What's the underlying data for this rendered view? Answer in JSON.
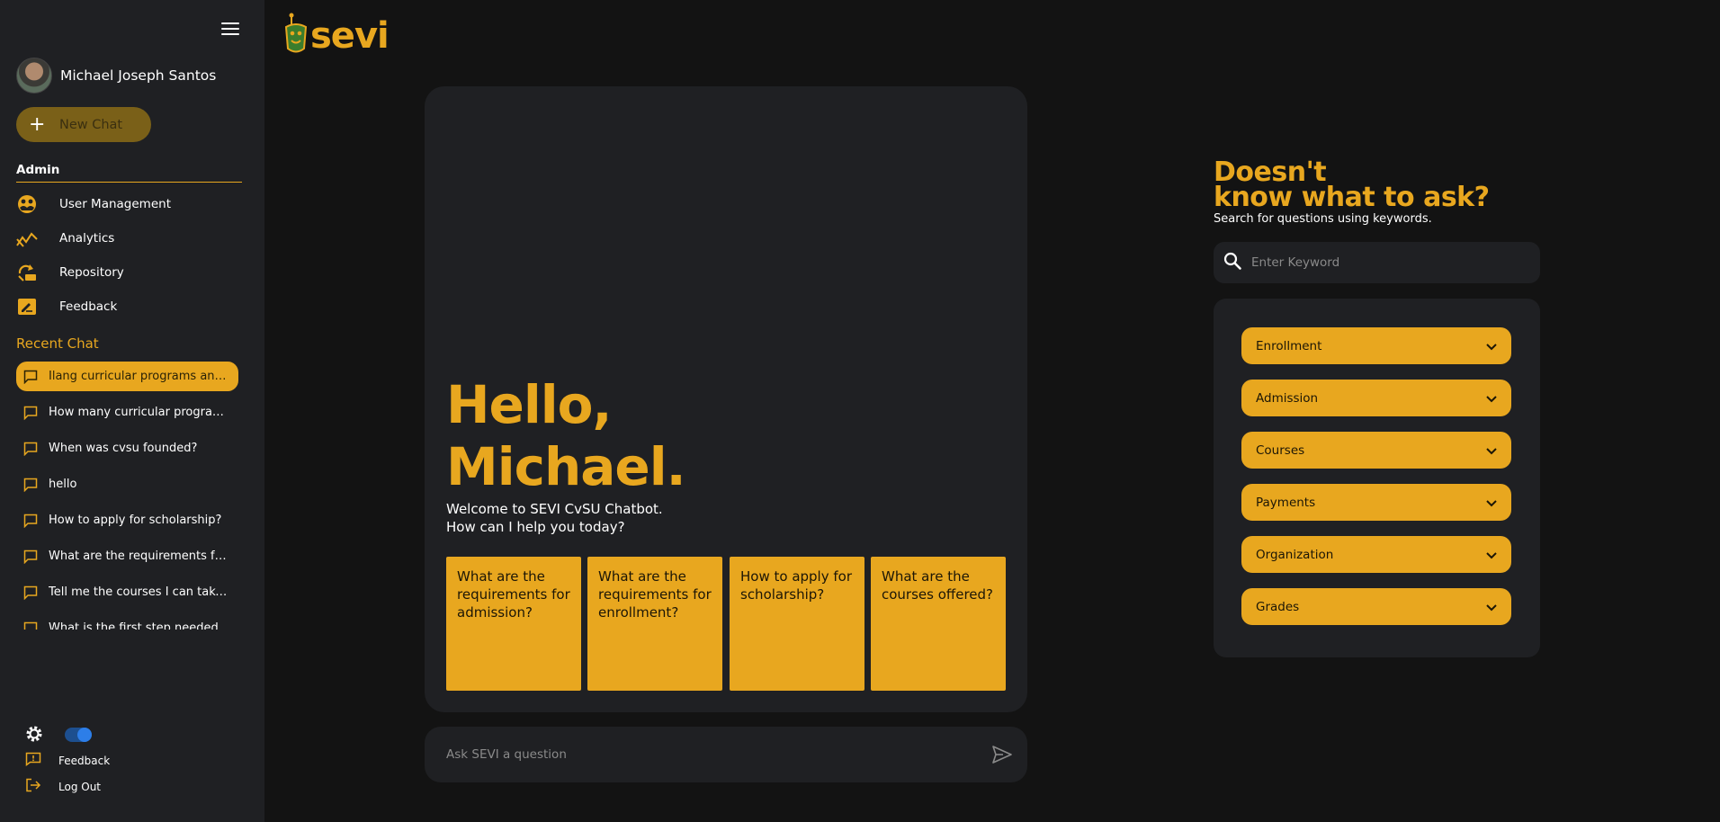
{
  "user": {
    "name": "Michael Joseph Santos"
  },
  "sidebar": {
    "new_chat_label": "New Chat",
    "admin_title": "Admin",
    "nav": [
      {
        "label": "User Management",
        "icon": "user-management-icon"
      },
      {
        "label": "Analytics",
        "icon": "analytics-icon"
      },
      {
        "label": "Repository",
        "icon": "repository-icon"
      },
      {
        "label": "Feedback",
        "icon": "feedback-icon"
      }
    ],
    "recent_title": "Recent Chat",
    "recent_chats": [
      "Ilang curricular programs ang i...",
      "How many curricular programs...",
      "When was cvsu founded?",
      "hello",
      "How to apply for scholarship?",
      "What are the requirements for ...",
      "Tell me the courses I can take in...",
      "What is the first step needed to..."
    ],
    "bottom": {
      "feedback_label": "Feedback",
      "logout_label": "Log Out",
      "theme_toggle_on": true
    }
  },
  "logo": {
    "text": "sevi"
  },
  "main": {
    "hello_line1": "Hello,",
    "hello_line2": "Michael.",
    "welcome_line1": "Welcome to SEVI CvSU Chatbot.",
    "welcome_line2": "How can I help you today?",
    "suggestions": [
      "What are the requirements for admission?",
      "What are the requirements for enrollment?",
      "How to apply for scholarship?",
      "What are the courses offered?"
    ],
    "ask_placeholder": "Ask SEVI a question"
  },
  "right_panel": {
    "title_line1": "Doesn't",
    "title_line2": "know what to ask?",
    "subtitle": "Search for questions using keywords.",
    "search_placeholder": "Enter Keyword",
    "categories": [
      "Enrollment",
      "Admission",
      "Courses",
      "Payments",
      "Organization",
      "Grades"
    ]
  },
  "colors": {
    "accent": "#e8a71f",
    "background": "#131313",
    "panel": "#1f2023",
    "toggle": "#2d7ee8"
  }
}
